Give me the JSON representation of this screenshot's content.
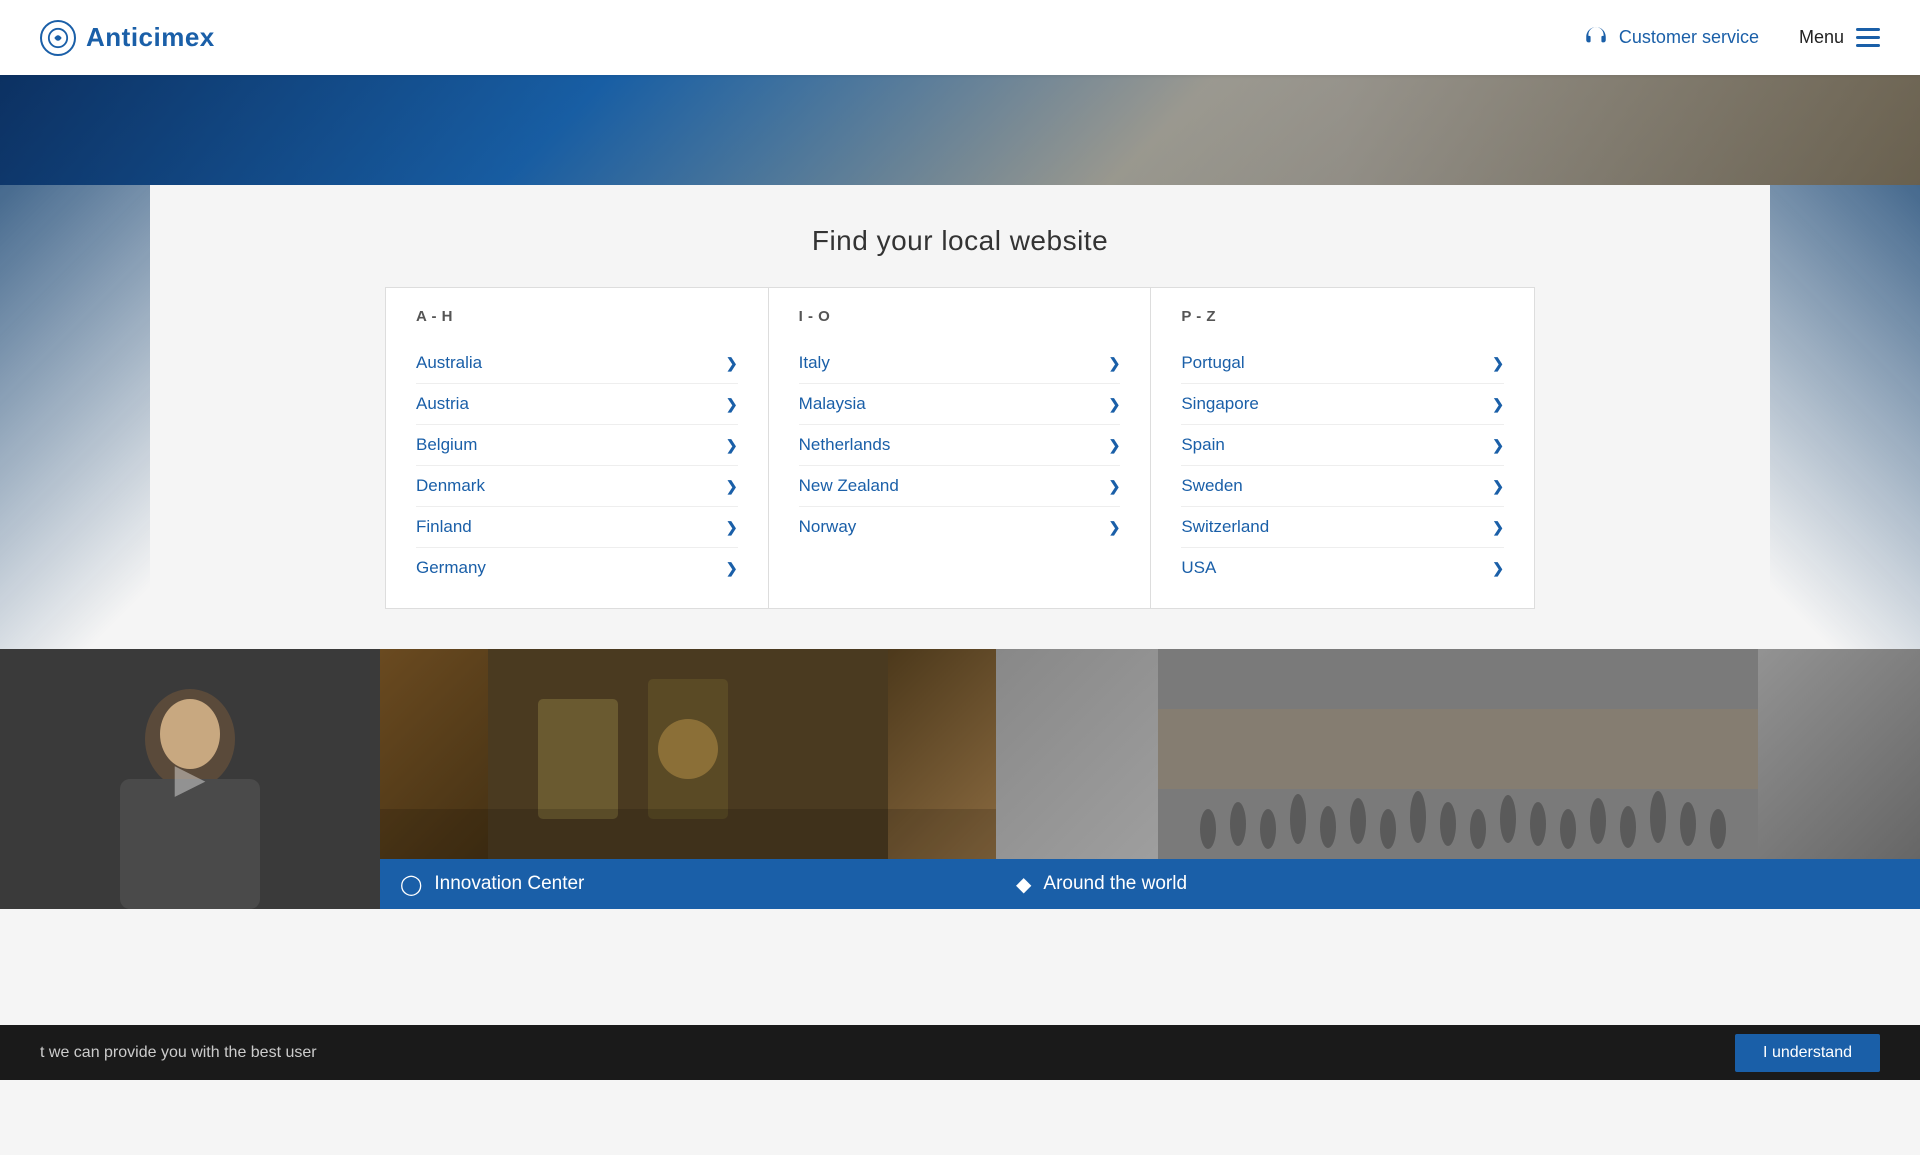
{
  "header": {
    "logo_text": "Anticimex",
    "customer_service_label": "Customer service",
    "menu_label": "Menu"
  },
  "page": {
    "section_title": "Find your local website"
  },
  "columns": [
    {
      "id": "a_h",
      "header": "A - H",
      "countries": [
        "Australia",
        "Austria",
        "Belgium",
        "Denmark",
        "Finland",
        "Germany"
      ]
    },
    {
      "id": "i_o",
      "header": "I - O",
      "countries": [
        "Italy",
        "Malaysia",
        "Netherlands",
        "New Zealand",
        "Norway"
      ]
    },
    {
      "id": "p_z",
      "header": "P - Z",
      "countries": [
        "Portugal",
        "Singapore",
        "Spain",
        "Sweden",
        "Switzerland",
        "USA"
      ]
    }
  ],
  "cards": [
    {
      "id": "innovation",
      "label": "Innovation Center"
    },
    {
      "id": "world",
      "label": "Around the world"
    }
  ],
  "cookie": {
    "text": "t we can provide you with the best user",
    "button_label": "I understand"
  }
}
